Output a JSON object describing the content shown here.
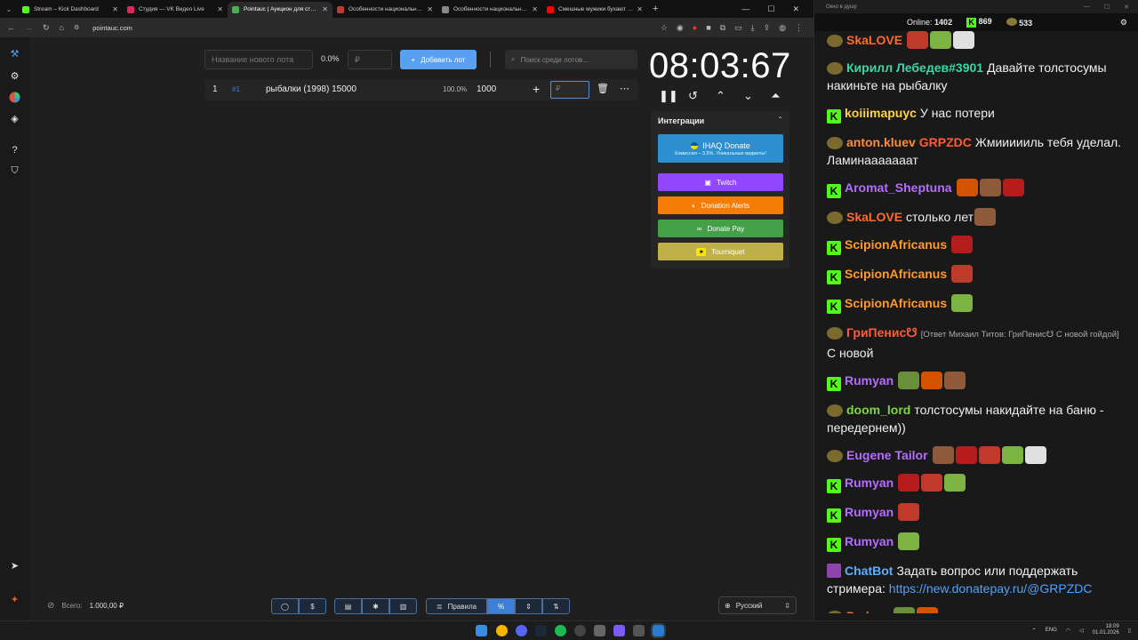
{
  "browser": {
    "tabs": [
      {
        "title": "Stream – Kick Dashboard",
        "color": "#53fc18",
        "active": false
      },
      {
        "title": "Студия — VK Видео Live",
        "color": "#e0245e",
        "active": false
      },
      {
        "title": "Pointauc | Аукцион для стрима",
        "color": "#4caf50",
        "active": true
      },
      {
        "title": "Особенности национальной рыб",
        "color": "#c0392b",
        "active": false
      },
      {
        "title": "Особенности национальной рыб",
        "color": "#888888",
        "active": false
      },
      {
        "title": "Смешные мужики бухают на рыб",
        "color": "#ff0000",
        "active": false
      }
    ],
    "url": "pointauc.com"
  },
  "app": {
    "new_lot_placeholder": "Название нового лота",
    "percent": "0.0%",
    "amount_placeholder": "₽",
    "add_lot_label": "Добавить лот",
    "search_placeholder": "Поиск среди лотов...",
    "lot": {
      "index": "1",
      "id": "#1",
      "name": "рыбалки (1998) 15000",
      "percent": "100.0%",
      "amount": "1000",
      "bet_placeholder": "₽"
    },
    "timer": "08:03:67",
    "integrations": {
      "title": "Интеграции",
      "ihaq_label": "IHAQ Donate",
      "ihaq_sub": "Комиссия – 3,5%. Уникальные виджеты!",
      "twitch_label": "Twitch",
      "donation_alerts_label": "Donation Alerts",
      "donate_pay_label": "Donate Pay",
      "tourniquet_label": "Tourniquet"
    },
    "total_label": "Всего:",
    "total_value": "1.000,00 ₽",
    "rules_label": "Правила",
    "language": "Русский"
  },
  "chat": {
    "window_title": "Окно в душу",
    "online_label": "Online:",
    "online_value": "1402",
    "kick_count": "869",
    "vk_count": "533",
    "messages": [
      {
        "src": "vk",
        "nick": "SkaLOVE",
        "color": "#ff6a2a",
        "text": ""
      },
      {
        "src": "vk",
        "nick": "Кирилл Лебедев#3901",
        "color": "#3dd6a6",
        "text": "Давайте толстосумы накиньте на рыбалку"
      },
      {
        "src": "kick",
        "nick": "koiiimapuyc",
        "color": "#ffd23f",
        "text": "У нас потери"
      },
      {
        "src": "vk",
        "nick": "anton.kluev",
        "color": "#ff8c3a",
        "reply": "GRPZDC",
        "text": "Жмиииииль тебя уделал. Ламинааааааат"
      },
      {
        "src": "kick",
        "nick": "Aromat_Sheptuna",
        "color": "#b56cff",
        "text": ""
      },
      {
        "src": "vk",
        "nick": "SkaLOVE",
        "color": "#ff6a2a",
        "text": "столько лет"
      },
      {
        "src": "kick",
        "nick": "ScipionAfricanus",
        "color": "#ff9a2a",
        "text": ""
      },
      {
        "src": "kick",
        "nick": "ScipionAfricanus",
        "color": "#ff9a2a",
        "text": ""
      },
      {
        "src": "kick",
        "nick": "ScipionAfricanus",
        "color": "#ff9a2a",
        "text": ""
      },
      {
        "src": "vk",
        "nick": "ГриПенис☋",
        "color": "#ff5a3a",
        "reply_text": "[Ответ Михаил Титов: ГриПенис☋ С новой гойдой]",
        "text": "С новой"
      },
      {
        "src": "kick",
        "nick": "Rumyan",
        "color": "#b56cff",
        "text": ""
      },
      {
        "src": "vk",
        "nick": "doom_lord",
        "color": "#7cd63f",
        "text": "толстосумы накидайте на баню - передернем))"
      },
      {
        "src": "vk",
        "nick": "Eugene Tailor",
        "color": "#b56cff",
        "text": ""
      },
      {
        "src": "kick",
        "nick": "Rumyan",
        "color": "#b56cff",
        "text": ""
      },
      {
        "src": "kick",
        "nick": "Rumyan",
        "color": "#b56cff",
        "text": ""
      },
      {
        "src": "kick",
        "nick": "Rumyan",
        "color": "#b56cff",
        "text": ""
      },
      {
        "src": "bot",
        "nick": "ChatBot",
        "color": "#5ab0ff",
        "text": "Задать вопрос или поддержать стримера:",
        "link": "https://new.donatepay.ru/@GRPZDC"
      },
      {
        "src": "vk",
        "nick": "Padoru",
        "color": "#ff6a2a",
        "text": ""
      }
    ]
  },
  "taskbar": {
    "lang": "ENG",
    "time": "18:09",
    "date": "01.01.2026"
  }
}
